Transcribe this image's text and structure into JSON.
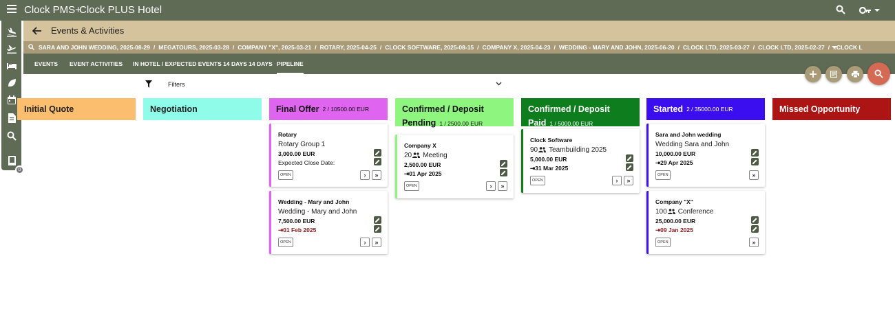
{
  "app": {
    "name": "Clock PMS+",
    "hotel": "Clock PLUS Hotel"
  },
  "page": {
    "title": "Events & Activities"
  },
  "breadcrumbs": [
    "SARA AND JOHN WEDDING, 2025-08-29",
    "MEGATOURS, 2025-03-28",
    "COMPANY \"X\", 2025-03-21",
    "ROTARY, 2025-04-25",
    "CLOCK SOFTWARE, 2025-08-15",
    "COMPANY X, 2025-04-23",
    "WEDDING - MARY AND JOHN, 2025-06-20",
    "CLOCK LTD, 2025-03-27",
    "CLOCK LTD, 2025-02-27",
    "..CLOCK L"
  ],
  "tabs": [
    "EVENTS",
    "EVENT ACTIVITIES",
    "IN HOTEL / EXPECTED EVENTS 14 DAYS 14 DAYS",
    "PIPELINE"
  ],
  "filters": {
    "label": "Filters"
  },
  "badge_count": "0",
  "colors": {
    "initial": "#fbbd6e",
    "negotiation": "#8efce8",
    "final": "#df64ef",
    "confirmed_pending": "#8ef57f",
    "confirmed_paid": "#0d7d1d",
    "started": "#3b0ef0",
    "missed": "#ad1414"
  },
  "columns": [
    {
      "title": "Initial Quote",
      "count": ""
    },
    {
      "title": "Negotiation",
      "count": ""
    },
    {
      "title": "Final Offer",
      "count": "2 / 10500.00 EUR"
    },
    {
      "title": "Confirmed / Deposit Pending",
      "count": "1 / 2500.00 EUR"
    },
    {
      "title": "Confirmed / Deposit Paid",
      "count": "1 / 5000.00 EUR"
    },
    {
      "title": "Started",
      "count": "2 / 35000.00 EUR"
    },
    {
      "title": "Missed Opportunity",
      "count": ""
    }
  ],
  "cards": [
    {
      "name": "Rotary",
      "sub": "Rotary Group 1",
      "amount": "3,000.00 EUR",
      "date": "Expected Close Date:",
      "status": "OPEN"
    },
    {
      "name": "Wedding - Mary and John",
      "sub": "Wedding - Mary and John",
      "amount": "7,500.00 EUR",
      "date": "⇥01 Feb 2025",
      "status": "OPEN"
    },
    {
      "name": "Company X",
      "pax": "20",
      "sub": "Meeting",
      "amount": "2,500.00 EUR",
      "date": "⇥01 Apr 2025",
      "status": "OPEN"
    },
    {
      "name": "Clock Software",
      "pax": "90",
      "sub": "Teambuilding 2025",
      "amount": "5,000.00 EUR",
      "date": "⇥31 Mar 2025",
      "status": "OPEN"
    },
    {
      "name": "Sara and John wedding",
      "sub": "Wedding Sara and John",
      "amount": "10,000.00 EUR",
      "date": "⇥29 Apr 2025",
      "status": "OPEN"
    },
    {
      "name": "Company \"X\"",
      "pax": "100",
      "sub": "Conference",
      "amount": "25,000.00 EUR",
      "date": "⇥09 Jan 2025",
      "status": "OPEN"
    }
  ]
}
